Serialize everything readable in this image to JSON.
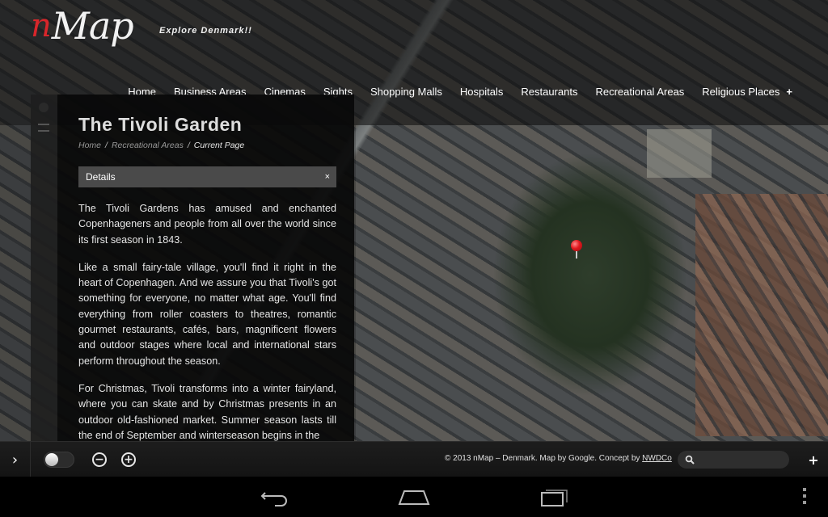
{
  "header": {
    "logo_initial": "n",
    "logo_rest": "Map",
    "tagline": "Explore Denmark!!",
    "nav_items": [
      "Home",
      "Business Areas",
      "Cinemas",
      "Sights",
      "Shopping Malls",
      "Hospitals",
      "Restaurants",
      "Recreational Areas",
      "Religious Places"
    ],
    "nav_more": "+"
  },
  "panel": {
    "title": "The Tivoli Garden",
    "breadcrumb": [
      "Home",
      "Recreational Areas",
      "Current Page"
    ],
    "breadcrumb_separator": "/",
    "details_label": "Details",
    "details_close": "×",
    "paragraphs": [
      "The Tivoli Gardens has amused and enchanted Copenhageners and people from all over the world since its first season in 1843.",
      "Like a small fairy-tale village, you'll find it right in the heart of Copenhagen. And we assure you that Tivoli's got something for everyone, no matter what age. You'll find everything from roller coasters to theatres, romantic gourmet restaurants, cafés, bars, magnificent flowers and outdoor stages where local and international stars perform throughout the season.",
      "For Christmas, Tivoli transforms into a winter fairyland, where you can skate and by Christmas presents in an outdoor old-fashioned market. Summer season lasts till the end of September and winterseason begins in the"
    ]
  },
  "map": {
    "marker_color": "#e0181e",
    "marker_icon": "map-pin-icon"
  },
  "toolbar": {
    "expand_symbol": "›",
    "toggle_on": false,
    "zoom_out_symbol": "−",
    "zoom_in_symbol": "+",
    "copyright_text": "© 2013 nMap – Denmark. Map by Google. Concept by ",
    "copyright_link": "NWDCo",
    "search_placeholder": "",
    "add_symbol": "+"
  },
  "system_bar": {
    "buttons": [
      "back-icon",
      "home-icon",
      "recent-apps-icon",
      "overflow-menu-icon"
    ]
  },
  "colors": {
    "brand_red": "#d8262b",
    "panel_bg": "#080808",
    "details_bar": "#4a4a4a"
  }
}
